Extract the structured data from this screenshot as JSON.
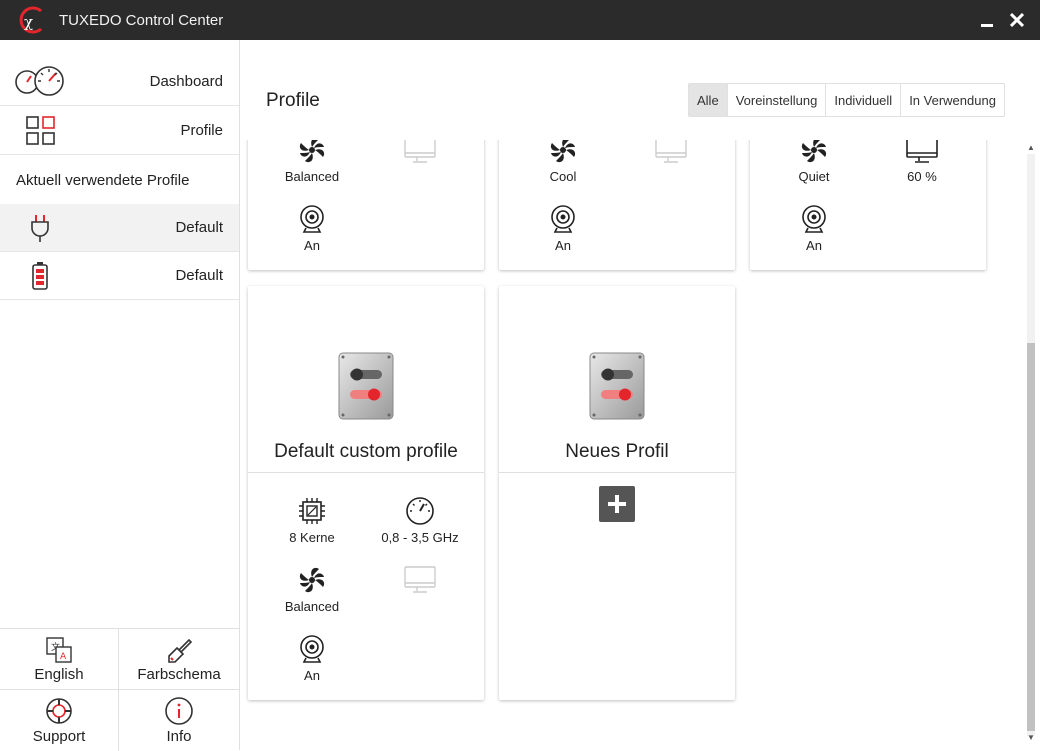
{
  "window": {
    "title": "TUXEDO Control Center",
    "minimize": "_",
    "close": "✕"
  },
  "sidebar": {
    "dashboard": "Dashboard",
    "profile": "Profile",
    "active_header": "Aktuell verwendete Profile",
    "active": [
      {
        "source": "ac-power",
        "label": "Default"
      },
      {
        "source": "battery",
        "label": "Default"
      }
    ],
    "bottom": {
      "language": "English",
      "theme": "Farbschema",
      "support": "Support",
      "info": "Info"
    }
  },
  "main": {
    "title": "Profile",
    "filters": [
      "Alle",
      "Voreinstellung",
      "Individuell",
      "In Verwendung"
    ],
    "active_filter": "Alle",
    "top_cards": [
      {
        "fan": "Balanced",
        "display": "",
        "webcam": "An"
      },
      {
        "fan": "Cool",
        "display": "",
        "webcam": "An"
      },
      {
        "fan": "Quiet",
        "display": "60 %",
        "webcam": "An"
      }
    ],
    "custom_card": {
      "name": "Default custom profile",
      "cpu": "8 Kerne",
      "freq": "0,8 - 3,5 GHz",
      "fan": "Balanced",
      "webcam": "An"
    },
    "new_card": {
      "name": "Neues Profil"
    }
  },
  "colors": {
    "accent": "#e3262b",
    "titlebar": "#2b2b2b",
    "active_row": "#f2f2f2"
  }
}
